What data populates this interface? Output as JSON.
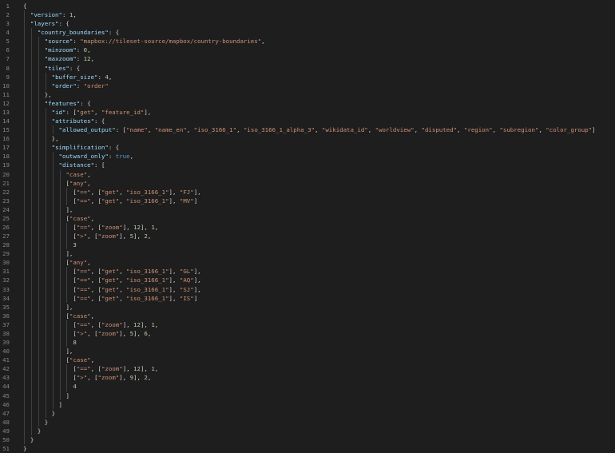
{
  "editor": {
    "colors": {
      "background": "#1e1e1e",
      "line_number": "#858585",
      "key": "#9cdcfe",
      "string": "#ce9178",
      "number": "#b5cea8",
      "boolean": "#569cd6",
      "punctuation": "#d4d4d4",
      "indent_guide": "#404040"
    },
    "lines": [
      {
        "n": "1",
        "indent": 0,
        "tokens": [
          [
            "p",
            "{"
          ]
        ]
      },
      {
        "n": "2",
        "indent": 1,
        "tokens": [
          [
            "k",
            "\"version\""
          ],
          [
            "p",
            ": "
          ],
          [
            "n",
            "1"
          ],
          [
            "p",
            ","
          ]
        ]
      },
      {
        "n": "3",
        "indent": 1,
        "tokens": [
          [
            "k",
            "\"layers\""
          ],
          [
            "p",
            ": {"
          ]
        ]
      },
      {
        "n": "4",
        "indent": 2,
        "tokens": [
          [
            "k",
            "\"country_boundaries\""
          ],
          [
            "p",
            ": {"
          ]
        ]
      },
      {
        "n": "5",
        "indent": 3,
        "tokens": [
          [
            "k",
            "\"source\""
          ],
          [
            "p",
            ": "
          ],
          [
            "s",
            "\"mapbox://tileset-source/mapbox/country-boundaries\""
          ],
          [
            "p",
            ","
          ]
        ]
      },
      {
        "n": "6",
        "indent": 3,
        "tokens": [
          [
            "k",
            "\"minzoom\""
          ],
          [
            "p",
            ": "
          ],
          [
            "n",
            "0"
          ],
          [
            "p",
            ","
          ]
        ]
      },
      {
        "n": "7",
        "indent": 3,
        "tokens": [
          [
            "k",
            "\"maxzoom\""
          ],
          [
            "p",
            ": "
          ],
          [
            "n",
            "12"
          ],
          [
            "p",
            ","
          ]
        ]
      },
      {
        "n": "8",
        "indent": 3,
        "tokens": [
          [
            "k",
            "\"tiles\""
          ],
          [
            "p",
            ": {"
          ]
        ]
      },
      {
        "n": "9",
        "indent": 4,
        "tokens": [
          [
            "k",
            "\"buffer_size\""
          ],
          [
            "p",
            ": "
          ],
          [
            "n",
            "4"
          ],
          [
            "p",
            ","
          ]
        ]
      },
      {
        "n": "10",
        "indent": 4,
        "tokens": [
          [
            "k",
            "\"order\""
          ],
          [
            "p",
            ": "
          ],
          [
            "s",
            "\"order\""
          ]
        ]
      },
      {
        "n": "11",
        "indent": 3,
        "tokens": [
          [
            "p",
            "},"
          ]
        ]
      },
      {
        "n": "12",
        "indent": 3,
        "tokens": [
          [
            "k",
            "\"features\""
          ],
          [
            "p",
            ": {"
          ]
        ]
      },
      {
        "n": "13",
        "indent": 4,
        "tokens": [
          [
            "k",
            "\"id\""
          ],
          [
            "p",
            ": ["
          ],
          [
            "s",
            "\"get\""
          ],
          [
            "p",
            ", "
          ],
          [
            "s",
            "\"feature_id\""
          ],
          [
            "p",
            "],"
          ]
        ]
      },
      {
        "n": "14",
        "indent": 4,
        "tokens": [
          [
            "k",
            "\"attributes\""
          ],
          [
            "p",
            ": {"
          ]
        ]
      },
      {
        "n": "15",
        "indent": 5,
        "tokens": [
          [
            "k",
            "\"allowed_output\""
          ],
          [
            "p",
            ": ["
          ],
          [
            "s",
            "\"name\""
          ],
          [
            "p",
            ", "
          ],
          [
            "s",
            "\"name_en\""
          ],
          [
            "p",
            ", "
          ],
          [
            "s",
            "\"iso_3166_1\""
          ],
          [
            "p",
            ", "
          ],
          [
            "s",
            "\"iso_3166_1_alpha_3\""
          ],
          [
            "p",
            ", "
          ],
          [
            "s",
            "\"wikidata_id\""
          ],
          [
            "p",
            ", "
          ],
          [
            "s",
            "\"worldview\""
          ],
          [
            "p",
            ", "
          ],
          [
            "s",
            "\"disputed\""
          ],
          [
            "p",
            ", "
          ],
          [
            "s",
            "\"region\""
          ],
          [
            "p",
            ", "
          ],
          [
            "s",
            "\"subregion\""
          ],
          [
            "p",
            ", "
          ],
          [
            "s",
            "\"color_group\""
          ],
          [
            "p",
            "]"
          ]
        ]
      },
      {
        "n": "16",
        "indent": 4,
        "tokens": [
          [
            "p",
            "},"
          ]
        ]
      },
      {
        "n": "17",
        "indent": 4,
        "tokens": [
          [
            "k",
            "\"simplification\""
          ],
          [
            "p",
            ": {"
          ]
        ]
      },
      {
        "n": "18",
        "indent": 5,
        "tokens": [
          [
            "k",
            "\"outward_only\""
          ],
          [
            "p",
            ": "
          ],
          [
            "b",
            "true"
          ],
          [
            "p",
            ","
          ]
        ]
      },
      {
        "n": "19",
        "indent": 5,
        "tokens": [
          [
            "k",
            "\"distance\""
          ],
          [
            "p",
            ": ["
          ]
        ]
      },
      {
        "n": "20",
        "indent": 6,
        "tokens": [
          [
            "s",
            "\"case\""
          ],
          [
            "p",
            ","
          ]
        ]
      },
      {
        "n": "21",
        "indent": 6,
        "tokens": [
          [
            "p",
            "["
          ],
          [
            "s",
            "\"any\""
          ],
          [
            "p",
            ","
          ]
        ]
      },
      {
        "n": "22",
        "indent": 7,
        "tokens": [
          [
            "p",
            "["
          ],
          [
            "s",
            "\"==\""
          ],
          [
            "p",
            ", ["
          ],
          [
            "s",
            "\"get\""
          ],
          [
            "p",
            ", "
          ],
          [
            "s",
            "\"iso_3166_1\""
          ],
          [
            "p",
            "], "
          ],
          [
            "s",
            "\"FJ\""
          ],
          [
            "p",
            "],"
          ]
        ]
      },
      {
        "n": "23",
        "indent": 7,
        "tokens": [
          [
            "p",
            "["
          ],
          [
            "s",
            "\"==\""
          ],
          [
            "p",
            ", ["
          ],
          [
            "s",
            "\"get\""
          ],
          [
            "p",
            ", "
          ],
          [
            "s",
            "\"iso_3166_1\""
          ],
          [
            "p",
            "], "
          ],
          [
            "s",
            "\"MV\""
          ],
          [
            "p",
            "]"
          ]
        ]
      },
      {
        "n": "24",
        "indent": 6,
        "tokens": [
          [
            "p",
            "],"
          ]
        ]
      },
      {
        "n": "25",
        "indent": 6,
        "tokens": [
          [
            "p",
            "["
          ],
          [
            "s",
            "\"case\""
          ],
          [
            "p",
            ","
          ]
        ]
      },
      {
        "n": "26",
        "indent": 7,
        "tokens": [
          [
            "p",
            "["
          ],
          [
            "s",
            "\"==\""
          ],
          [
            "p",
            ", ["
          ],
          [
            "s",
            "\"zoom\""
          ],
          [
            "p",
            "], "
          ],
          [
            "n",
            "12"
          ],
          [
            "p",
            "], "
          ],
          [
            "n",
            "1"
          ],
          [
            "p",
            ","
          ]
        ]
      },
      {
        "n": "27",
        "indent": 7,
        "tokens": [
          [
            "p",
            "["
          ],
          [
            "s",
            "\">\""
          ],
          [
            "p",
            ", ["
          ],
          [
            "s",
            "\"zoom\""
          ],
          [
            "p",
            "], "
          ],
          [
            "n",
            "5"
          ],
          [
            "p",
            "], "
          ],
          [
            "n",
            "2"
          ],
          [
            "p",
            ","
          ]
        ]
      },
      {
        "n": "28",
        "indent": 7,
        "tokens": [
          [
            "n",
            "3"
          ]
        ]
      },
      {
        "n": "29",
        "indent": 6,
        "tokens": [
          [
            "p",
            "],"
          ]
        ]
      },
      {
        "n": "30",
        "indent": 6,
        "tokens": [
          [
            "p",
            "["
          ],
          [
            "s",
            "\"any\""
          ],
          [
            "p",
            ","
          ]
        ]
      },
      {
        "n": "31",
        "indent": 7,
        "tokens": [
          [
            "p",
            "["
          ],
          [
            "s",
            "\"==\""
          ],
          [
            "p",
            ", ["
          ],
          [
            "s",
            "\"get\""
          ],
          [
            "p",
            ", "
          ],
          [
            "s",
            "\"iso_3166_1\""
          ],
          [
            "p",
            "], "
          ],
          [
            "s",
            "\"GL\""
          ],
          [
            "p",
            "],"
          ]
        ]
      },
      {
        "n": "32",
        "indent": 7,
        "tokens": [
          [
            "p",
            "["
          ],
          [
            "s",
            "\"==\""
          ],
          [
            "p",
            ", ["
          ],
          [
            "s",
            "\"get\""
          ],
          [
            "p",
            ", "
          ],
          [
            "s",
            "\"iso_3166_1\""
          ],
          [
            "p",
            "], "
          ],
          [
            "s",
            "\"AQ\""
          ],
          [
            "p",
            "],"
          ]
        ]
      },
      {
        "n": "33",
        "indent": 7,
        "tokens": [
          [
            "p",
            "["
          ],
          [
            "s",
            "\"==\""
          ],
          [
            "p",
            ", ["
          ],
          [
            "s",
            "\"get\""
          ],
          [
            "p",
            ", "
          ],
          [
            "s",
            "\"iso_3166_1\""
          ],
          [
            "p",
            "], "
          ],
          [
            "s",
            "\"SJ\""
          ],
          [
            "p",
            "],"
          ]
        ]
      },
      {
        "n": "34",
        "indent": 7,
        "tokens": [
          [
            "p",
            "["
          ],
          [
            "s",
            "\"==\""
          ],
          [
            "p",
            ", ["
          ],
          [
            "s",
            "\"get\""
          ],
          [
            "p",
            ", "
          ],
          [
            "s",
            "\"iso_3166_1\""
          ],
          [
            "p",
            "], "
          ],
          [
            "s",
            "\"IS\""
          ],
          [
            "p",
            "]"
          ]
        ]
      },
      {
        "n": "35",
        "indent": 6,
        "tokens": [
          [
            "p",
            "],"
          ]
        ]
      },
      {
        "n": "36",
        "indent": 6,
        "tokens": [
          [
            "p",
            "["
          ],
          [
            "s",
            "\"case\""
          ],
          [
            "p",
            ","
          ]
        ]
      },
      {
        "n": "37",
        "indent": 7,
        "tokens": [
          [
            "p",
            "["
          ],
          [
            "s",
            "\"==\""
          ],
          [
            "p",
            ", ["
          ],
          [
            "s",
            "\"zoom\""
          ],
          [
            "p",
            "], "
          ],
          [
            "n",
            "12"
          ],
          [
            "p",
            "], "
          ],
          [
            "n",
            "1"
          ],
          [
            "p",
            ","
          ]
        ]
      },
      {
        "n": "38",
        "indent": 7,
        "tokens": [
          [
            "p",
            "["
          ],
          [
            "s",
            "\">\""
          ],
          [
            "p",
            ", ["
          ],
          [
            "s",
            "\"zoom\""
          ],
          [
            "p",
            "], "
          ],
          [
            "n",
            "5"
          ],
          [
            "p",
            "], "
          ],
          [
            "n",
            "6"
          ],
          [
            "p",
            ","
          ]
        ]
      },
      {
        "n": "39",
        "indent": 7,
        "tokens": [
          [
            "n",
            "8"
          ]
        ]
      },
      {
        "n": "40",
        "indent": 6,
        "tokens": [
          [
            "p",
            "],"
          ]
        ]
      },
      {
        "n": "41",
        "indent": 6,
        "tokens": [
          [
            "p",
            "["
          ],
          [
            "s",
            "\"case\""
          ],
          [
            "p",
            ","
          ]
        ]
      },
      {
        "n": "42",
        "indent": 7,
        "tokens": [
          [
            "p",
            "["
          ],
          [
            "s",
            "\"==\""
          ],
          [
            "p",
            ", ["
          ],
          [
            "s",
            "\"zoom\""
          ],
          [
            "p",
            "], "
          ],
          [
            "n",
            "12"
          ],
          [
            "p",
            "], "
          ],
          [
            "n",
            "1"
          ],
          [
            "p",
            ","
          ]
        ]
      },
      {
        "n": "43",
        "indent": 7,
        "tokens": [
          [
            "p",
            "["
          ],
          [
            "s",
            "\">\""
          ],
          [
            "p",
            ", ["
          ],
          [
            "s",
            "\"zoom\""
          ],
          [
            "p",
            "], "
          ],
          [
            "n",
            "9"
          ],
          [
            "p",
            "], "
          ],
          [
            "n",
            "2"
          ],
          [
            "p",
            ","
          ]
        ]
      },
      {
        "n": "44",
        "indent": 7,
        "tokens": [
          [
            "n",
            "4"
          ]
        ]
      },
      {
        "n": "45",
        "indent": 6,
        "tokens": [
          [
            "p",
            "]"
          ]
        ]
      },
      {
        "n": "46",
        "indent": 5,
        "tokens": [
          [
            "p",
            "]"
          ]
        ]
      },
      {
        "n": "47",
        "indent": 4,
        "tokens": [
          [
            "p",
            "}"
          ]
        ]
      },
      {
        "n": "48",
        "indent": 3,
        "tokens": [
          [
            "p",
            "}"
          ]
        ]
      },
      {
        "n": "49",
        "indent": 2,
        "tokens": [
          [
            "p",
            "}"
          ]
        ]
      },
      {
        "n": "50",
        "indent": 1,
        "tokens": [
          [
            "p",
            "}"
          ]
        ]
      },
      {
        "n": "51",
        "indent": 0,
        "tokens": [
          [
            "p",
            "}"
          ]
        ]
      }
    ]
  }
}
